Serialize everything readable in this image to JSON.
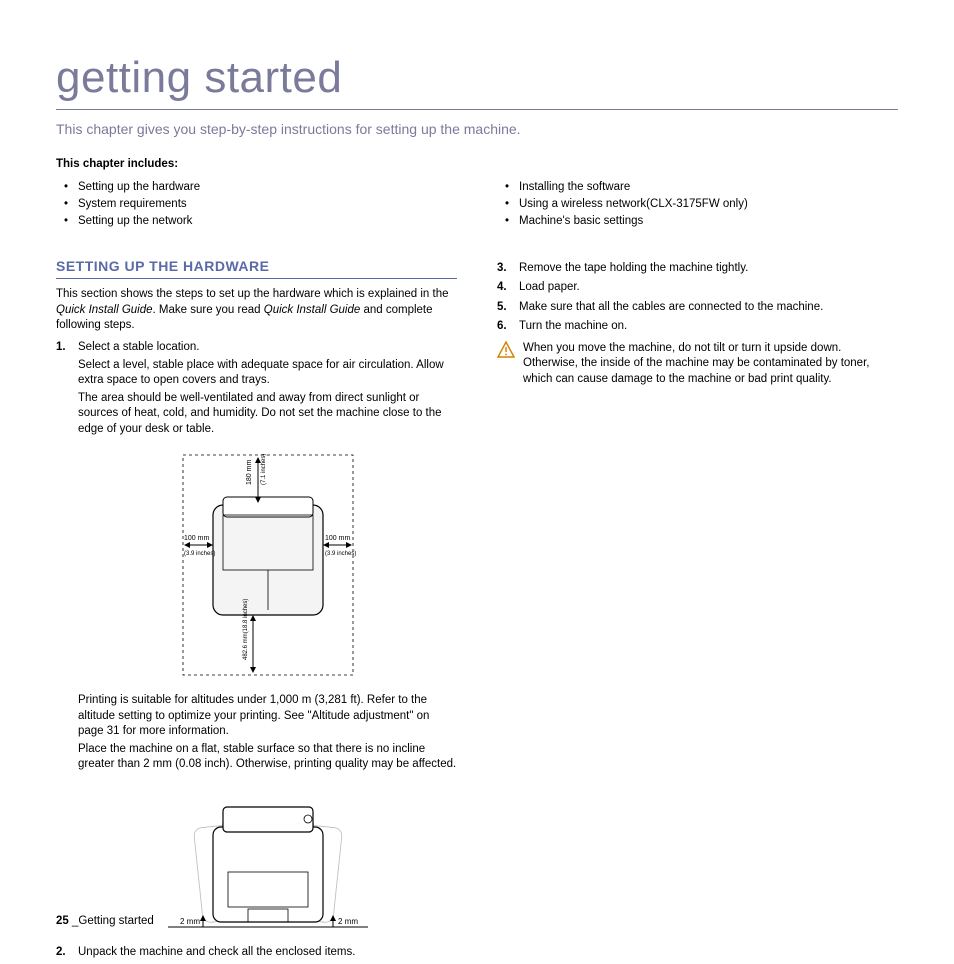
{
  "chapter": {
    "title": "getting started",
    "intro": "This chapter gives you step-by-step instructions for setting up the machine.",
    "includes_label": "This chapter includes:"
  },
  "toc": {
    "left": [
      "Setting up the hardware",
      "System requirements",
      "Setting up the network"
    ],
    "right": [
      "Installing the software",
      "Using a wireless network(CLX-3175FW only)",
      "Machine's basic settings"
    ]
  },
  "section": {
    "heading": "SETTING UP THE HARDWARE",
    "intro_a": "This section shows the steps to set up the hardware which is explained in the ",
    "intro_qig1": "Quick Install Guide",
    "intro_b": ". Make sure you read ",
    "intro_qig2": "Quick Install Guide",
    "intro_c": " and complete following steps."
  },
  "steps_left": {
    "s1_title": "Select a stable location.",
    "s1_p1": "Select a level, stable place with adequate space for air circulation. Allow extra space to open covers and trays.",
    "s1_p2": "The area should be well-ventilated and away from direct sunlight or sources of heat, cold, and humidity. Do not set the machine close to the edge of your desk or table.",
    "s1_p3": "Printing is suitable for altitudes under 1,000 m (3,281 ft). Refer to the altitude setting to optimize your printing. See \"Altitude adjustment\" on page 31 for more information.",
    "s1_p4": "Place the machine on a flat, stable surface so that there is no incline greater than 2 mm (0.08 inch). Otherwise, printing quality may be affected.",
    "s2": "Unpack the machine and check all the enclosed items."
  },
  "steps_right": {
    "s3": "Remove the tape holding the machine tightly.",
    "s4": "Load paper.",
    "s5": "Make sure that all the cables are connected to the machine.",
    "s6": "Turn the machine on."
  },
  "warning": "When you move the machine, do not tilt or turn it upside down. Otherwise, the inside of the machine may be contaminated by toner, which can cause damage to the machine or bad print quality.",
  "fig1": {
    "top": "180 mm",
    "top_in": "(7.1 inches)",
    "left": "100 mm",
    "left_in": "(3.9 inches)",
    "right": "100 mm",
    "right_in": "(3.9 inches)",
    "bottom": "482.6 mm(18.8 inches)"
  },
  "fig2": {
    "left": "2 mm",
    "right": "2 mm"
  },
  "footer": {
    "page": "25",
    "sep": " _",
    "label": "Getting started"
  }
}
